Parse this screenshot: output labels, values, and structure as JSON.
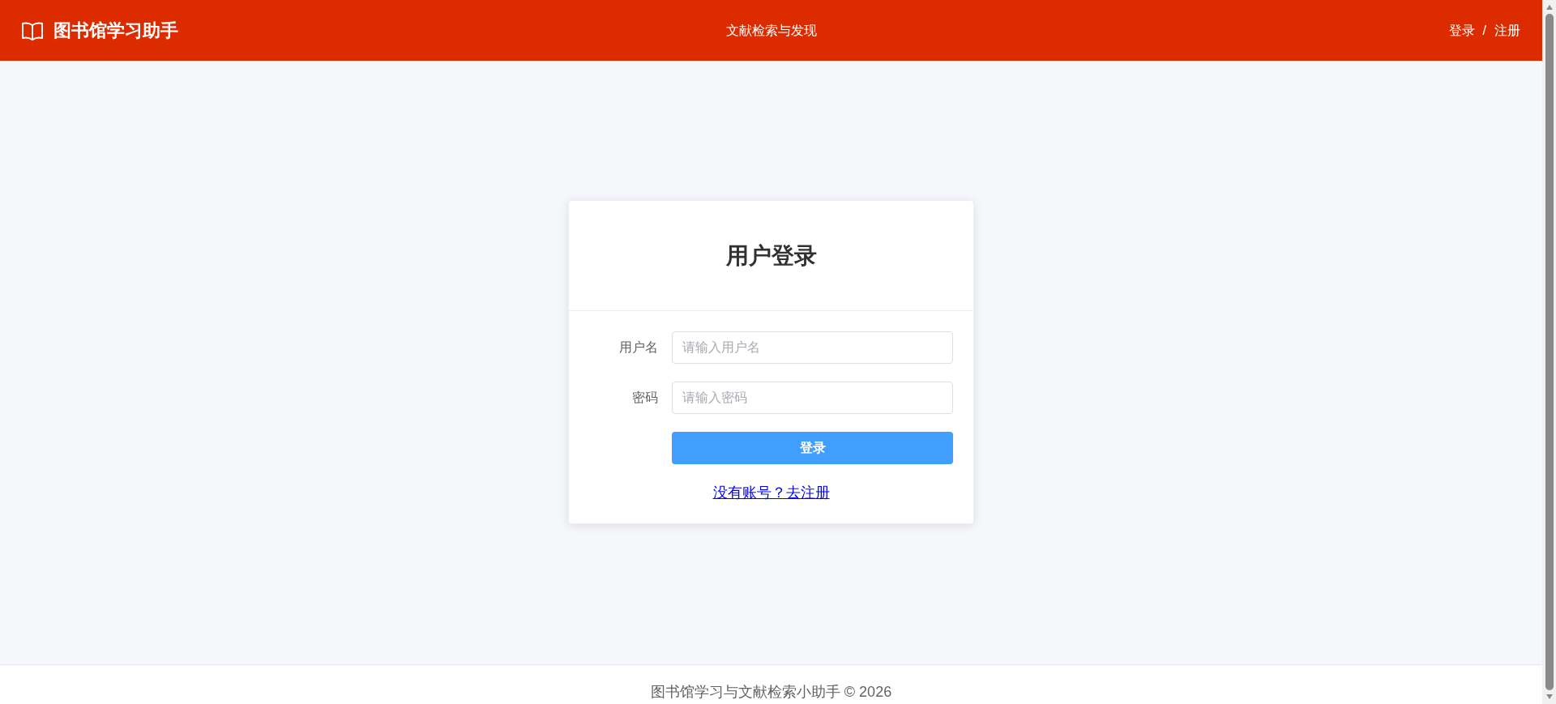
{
  "header": {
    "brand": "图书馆学习助手",
    "nav": [
      "文献检索与发现"
    ],
    "auth": {
      "login": "登录",
      "separator": "/",
      "register": "注册"
    }
  },
  "login_card": {
    "title": "用户登录",
    "fields": [
      {
        "label": "用户名",
        "placeholder": "请输入用户名"
      },
      {
        "label": "密码",
        "placeholder": "请输入密码"
      }
    ],
    "submit": "登录",
    "register_link": "没有账号？去注册"
  },
  "footer": "图书馆学习与文献检索小助手 © 2026"
}
